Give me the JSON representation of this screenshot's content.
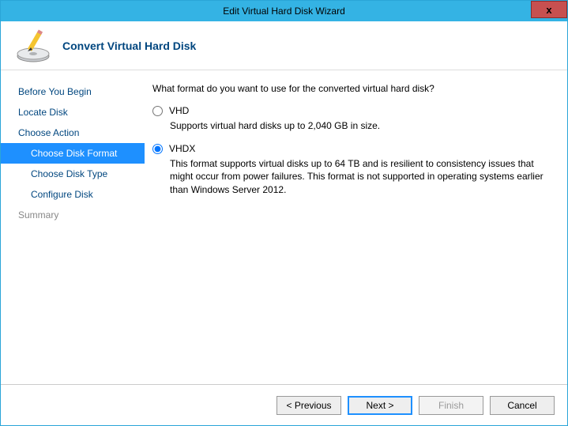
{
  "titlebar": {
    "title": "Edit Virtual Hard Disk Wizard",
    "close_label": "x"
  },
  "header": {
    "title": "Convert Virtual Hard Disk"
  },
  "sidebar": {
    "items": [
      {
        "label": "Before You Begin",
        "sub": false,
        "selected": false,
        "disabled": false
      },
      {
        "label": "Locate Disk",
        "sub": false,
        "selected": false,
        "disabled": false
      },
      {
        "label": "Choose Action",
        "sub": false,
        "selected": false,
        "disabled": false
      },
      {
        "label": "Choose Disk Format",
        "sub": true,
        "selected": true,
        "disabled": false
      },
      {
        "label": "Choose Disk Type",
        "sub": true,
        "selected": false,
        "disabled": false
      },
      {
        "label": "Configure Disk",
        "sub": true,
        "selected": false,
        "disabled": false
      },
      {
        "label": "Summary",
        "sub": false,
        "selected": false,
        "disabled": true
      }
    ]
  },
  "content": {
    "question": "What format do you want to use for the converted virtual hard disk?",
    "options": [
      {
        "value": "vhd",
        "label": "VHD",
        "desc": "Supports virtual hard disks up to 2,040 GB in size.",
        "checked": false
      },
      {
        "value": "vhdx",
        "label": "VHDX",
        "desc": "This format supports virtual disks up to 64 TB and is resilient to consistency issues that might occur from power failures. This format is not supported in operating systems earlier than Windows Server 2012.",
        "checked": true
      }
    ]
  },
  "footer": {
    "previous": "< Previous",
    "next": "Next >",
    "finish": "Finish",
    "cancel": "Cancel"
  }
}
